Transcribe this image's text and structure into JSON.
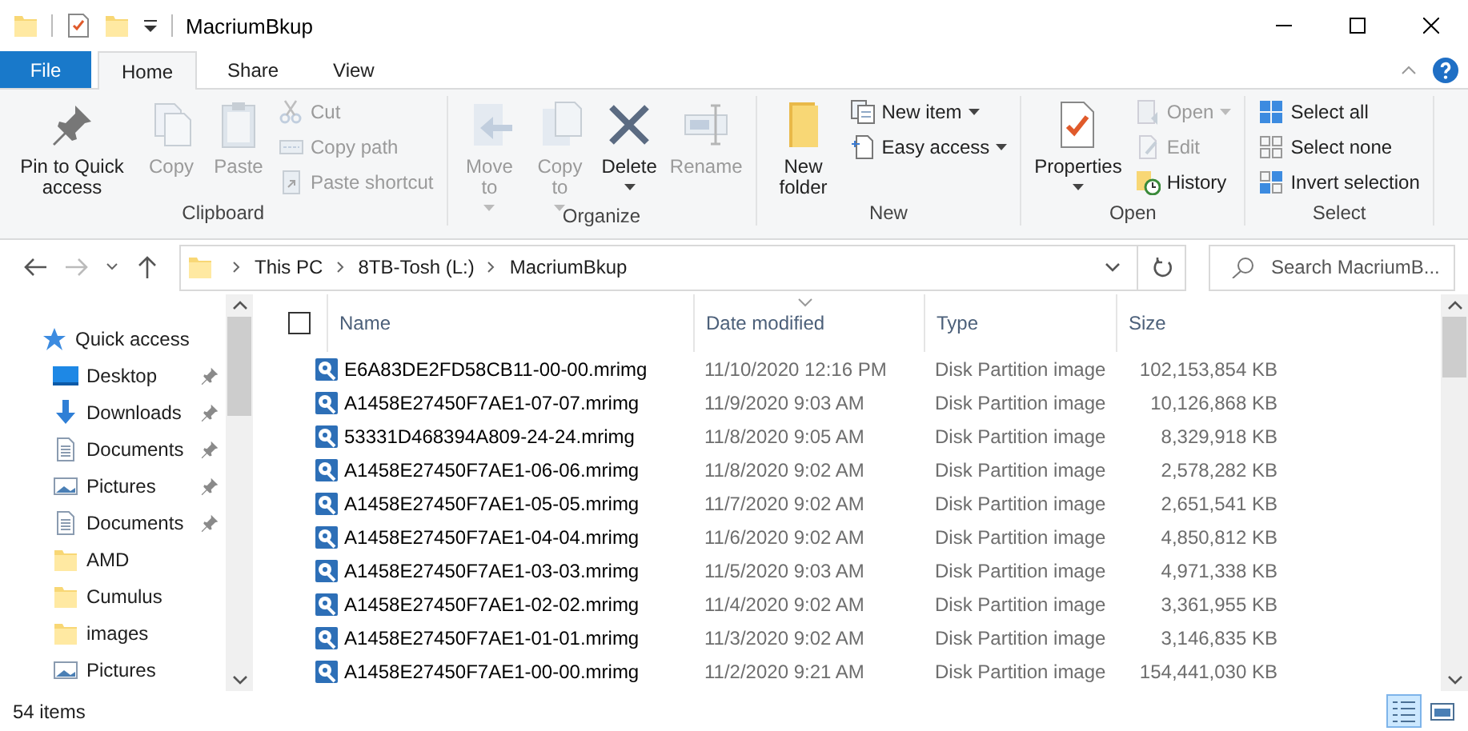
{
  "window": {
    "title": "MacriumBkup"
  },
  "ribbon_tabs": [
    {
      "label": "File",
      "kind": "file",
      "selected": false
    },
    {
      "label": "Home",
      "kind": "tab",
      "selected": true
    },
    {
      "label": "Share",
      "kind": "tab",
      "selected": false
    },
    {
      "label": "View",
      "kind": "tab",
      "selected": false
    }
  ],
  "ribbon_groups": [
    {
      "label": "Clipboard",
      "items": [
        {
          "label": "Pin to Quick access",
          "kind": "large",
          "disabled": false,
          "dropdown": false
        },
        {
          "label": "Copy",
          "kind": "large",
          "disabled": true,
          "dropdown": false
        },
        {
          "label": "Paste",
          "kind": "large",
          "disabled": true,
          "dropdown": false
        },
        {
          "label": "Cut",
          "kind": "small",
          "disabled": true,
          "dropdown": false
        },
        {
          "label": "Copy path",
          "kind": "small",
          "disabled": true,
          "dropdown": false
        },
        {
          "label": "Paste shortcut",
          "kind": "small",
          "disabled": true,
          "dropdown": false
        }
      ]
    },
    {
      "label": "Organize",
      "items": [
        {
          "label": "Move to",
          "kind": "large",
          "disabled": true,
          "dropdown": true
        },
        {
          "label": "Copy to",
          "kind": "large",
          "disabled": true,
          "dropdown": true
        },
        {
          "label": "Delete",
          "kind": "large",
          "disabled": false,
          "dropdown": true
        },
        {
          "label": "Rename",
          "kind": "large",
          "disabled": true,
          "dropdown": false
        }
      ]
    },
    {
      "label": "New",
      "items": [
        {
          "label": "New folder",
          "kind": "large",
          "disabled": false,
          "dropdown": false
        },
        {
          "label": "New item",
          "kind": "small",
          "disabled": false,
          "dropdown": true
        },
        {
          "label": "Easy access",
          "kind": "small",
          "disabled": false,
          "dropdown": true
        }
      ]
    },
    {
      "label": "Open",
      "items": [
        {
          "label": "Properties",
          "kind": "large",
          "disabled": false,
          "dropdown": true
        },
        {
          "label": "Open",
          "kind": "small",
          "disabled": true,
          "dropdown": true
        },
        {
          "label": "Edit",
          "kind": "small",
          "disabled": true,
          "dropdown": false
        },
        {
          "label": "History",
          "kind": "small",
          "disabled": false,
          "dropdown": false
        }
      ]
    },
    {
      "label": "Select",
      "items": [
        {
          "label": "Select all",
          "kind": "small",
          "disabled": false,
          "dropdown": false
        },
        {
          "label": "Select none",
          "kind": "small",
          "disabled": false,
          "dropdown": false
        },
        {
          "label": "Invert selection",
          "kind": "small",
          "disabled": false,
          "dropdown": false
        }
      ]
    }
  ],
  "navigation": {
    "back_disabled": false,
    "forward_disabled": true
  },
  "address": {
    "breadcrumbs": [
      "This PC",
      "8TB-Tosh (L:)",
      "MacriumBkup"
    ]
  },
  "search": {
    "placeholder": "Search MacriumB..."
  },
  "sidebar": {
    "items": [
      {
        "label": "Quick access",
        "kind": "quick",
        "pinned": false
      },
      {
        "label": "Desktop",
        "kind": "desktop",
        "pinned": true
      },
      {
        "label": "Downloads",
        "kind": "downloads",
        "pinned": true
      },
      {
        "label": "Documents",
        "kind": "document",
        "pinned": true
      },
      {
        "label": "Pictures",
        "kind": "pictures",
        "pinned": true
      },
      {
        "label": "Documents",
        "kind": "document",
        "pinned": true
      },
      {
        "label": "AMD",
        "kind": "folder",
        "pinned": false
      },
      {
        "label": "Cumulus",
        "kind": "folder",
        "pinned": false
      },
      {
        "label": "images",
        "kind": "folder",
        "pinned": false
      },
      {
        "label": "Pictures",
        "kind": "pictures",
        "pinned": false
      }
    ]
  },
  "file_list": {
    "select_all_checked": false,
    "columns": [
      {
        "label": "Name",
        "sorted": false
      },
      {
        "label": "Date modified",
        "sorted": true
      },
      {
        "label": "Type",
        "sorted": false
      },
      {
        "label": "Size",
        "sorted": false
      }
    ],
    "rows": [
      {
        "name": "E6A83DE2FD58CB11-00-00.mrimg",
        "date": "11/10/2020 12:16 PM",
        "type": "Disk Partition image",
        "size": "102,153,854 KB"
      },
      {
        "name": "A1458E27450F7AE1-07-07.mrimg",
        "date": "11/9/2020 9:03 AM",
        "type": "Disk Partition image",
        "size": "10,126,868 KB"
      },
      {
        "name": "53331D468394A809-24-24.mrimg",
        "date": "11/8/2020 9:05 AM",
        "type": "Disk Partition image",
        "size": "8,329,918 KB"
      },
      {
        "name": "A1458E27450F7AE1-06-06.mrimg",
        "date": "11/8/2020 9:02 AM",
        "type": "Disk Partition image",
        "size": "2,578,282 KB"
      },
      {
        "name": "A1458E27450F7AE1-05-05.mrimg",
        "date": "11/7/2020 9:02 AM",
        "type": "Disk Partition image",
        "size": "2,651,541 KB"
      },
      {
        "name": "A1458E27450F7AE1-04-04.mrimg",
        "date": "11/6/2020 9:02 AM",
        "type": "Disk Partition image",
        "size": "4,850,812 KB"
      },
      {
        "name": "A1458E27450F7AE1-03-03.mrimg",
        "date": "11/5/2020 9:03 AM",
        "type": "Disk Partition image",
        "size": "4,971,338 KB"
      },
      {
        "name": "A1458E27450F7AE1-02-02.mrimg",
        "date": "11/4/2020 9:02 AM",
        "type": "Disk Partition image",
        "size": "3,361,955 KB"
      },
      {
        "name": "A1458E27450F7AE1-01-01.mrimg",
        "date": "11/3/2020 9:02 AM",
        "type": "Disk Partition image",
        "size": "3,146,835 KB"
      },
      {
        "name": "A1458E27450F7AE1-00-00.mrimg",
        "date": "11/2/2020 9:21 AM",
        "type": "Disk Partition image",
        "size": "154,441,030 KB"
      }
    ]
  },
  "status_bar": {
    "item_count": "54 items",
    "view_buttons": [
      {
        "kind": "details",
        "selected": true
      },
      {
        "kind": "tiles",
        "selected": false
      }
    ]
  }
}
